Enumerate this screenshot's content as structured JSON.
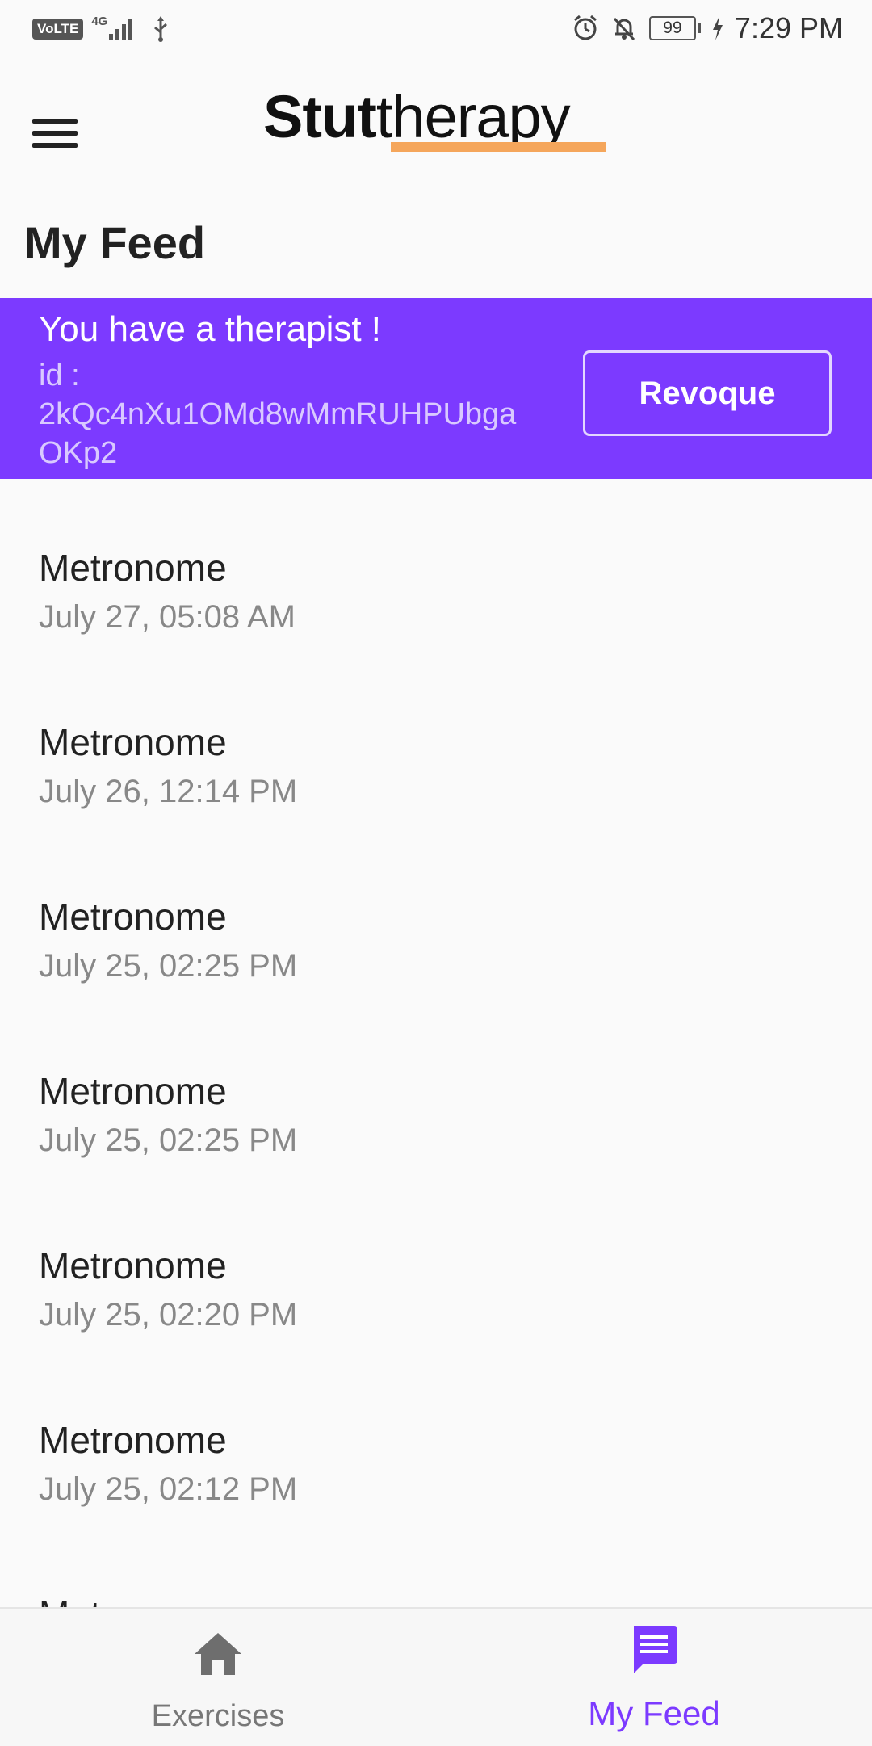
{
  "status_bar": {
    "volte": "VoLTE",
    "network": "4G",
    "time": "7:29 PM",
    "battery": "99"
  },
  "app": {
    "logo_bold": "Stut",
    "logo_regular": "therapy",
    "accent_color": "#7C3AFF",
    "logo_underline_color": "#F5A65B"
  },
  "page": {
    "title": "My Feed"
  },
  "banner": {
    "title": "You have a therapist !",
    "id_label": "id :",
    "id_value": "2kQc4nXu1OMd8wMmRUHPUbgaOKp2",
    "revoque_label": "Revoque"
  },
  "feed": {
    "items": [
      {
        "title": "Metronome",
        "date": "July 27, 05:08 AM"
      },
      {
        "title": "Metronome",
        "date": "July 26, 12:14 PM"
      },
      {
        "title": "Metronome",
        "date": "July 25, 02:25 PM"
      },
      {
        "title": "Metronome",
        "date": "July 25, 02:25 PM"
      },
      {
        "title": "Metronome",
        "date": "July 25, 02:20 PM"
      },
      {
        "title": "Metronome",
        "date": "July 25, 02:12 PM"
      },
      {
        "title": "Metronome",
        "date": ""
      }
    ]
  },
  "bottom_nav": {
    "items": [
      {
        "label": "Exercises",
        "icon": "home-icon",
        "active": false
      },
      {
        "label": "My Feed",
        "icon": "message-icon",
        "active": true
      }
    ]
  }
}
